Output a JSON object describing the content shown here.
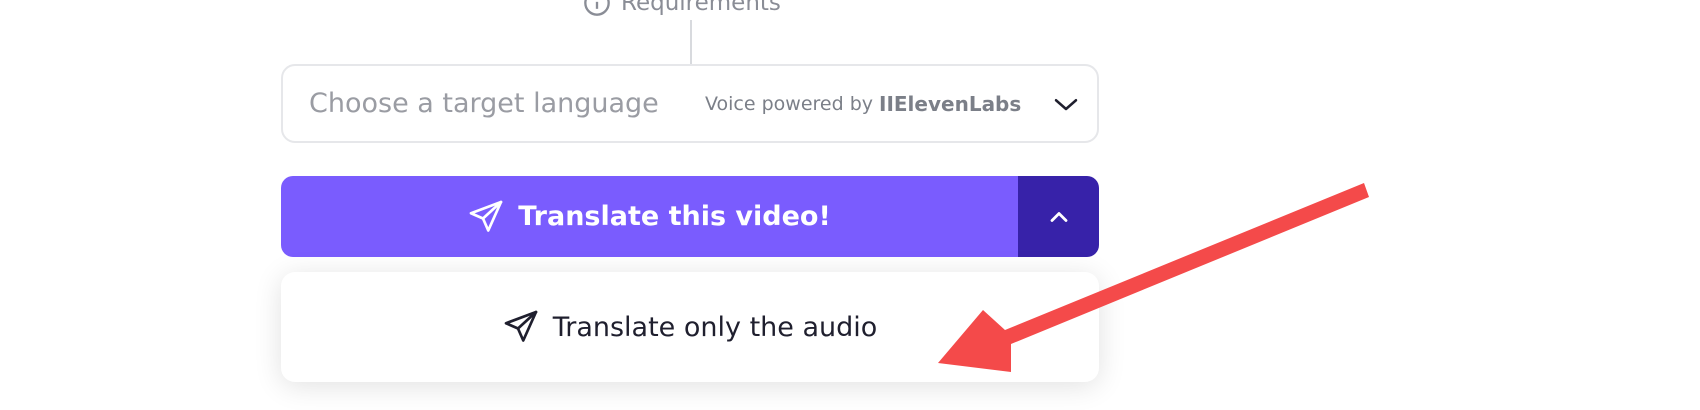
{
  "requirements": {
    "label": "Requirements"
  },
  "language_select": {
    "placeholder": "Choose a target language",
    "powered_by": "Voice powered by",
    "brand": "IIElevenLabs"
  },
  "primary_action": {
    "label": "Translate this video!"
  },
  "menu": {
    "items": [
      {
        "label": "Translate only the audio"
      }
    ]
  },
  "icons": {
    "requirements": "info-icon",
    "select": "chevron-down-icon",
    "primary": "paper-plane-icon",
    "toggle": "chevron-up-icon",
    "menu_item": "paper-plane-icon"
  },
  "colors": {
    "primary": "#7a5cfe",
    "primary_dark": "#3722a9",
    "annotation_arrow": "#f44a4a"
  }
}
